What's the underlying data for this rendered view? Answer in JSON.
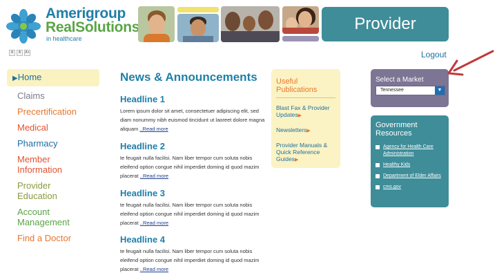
{
  "logo": {
    "line1": "Amerigroup",
    "line2": "RealSolutions",
    "line3": "in healthcare"
  },
  "header": {
    "banner": "Provider",
    "logout": "Logout",
    "text_size_buttons": [
      "A",
      "A",
      "A+"
    ]
  },
  "nav": {
    "items": [
      {
        "label": "Home",
        "color": "#1f6f9e",
        "active": true
      },
      {
        "label": "Claims",
        "color": "#7d7a8c"
      },
      {
        "label": "Precertification",
        "color": "#e8762c"
      },
      {
        "label": "Medical",
        "color": "#e2522f"
      },
      {
        "label": "Pharmacy",
        "color": "#1f6f9e"
      },
      {
        "label": "Member Information",
        "color": "#e2522f"
      },
      {
        "label": "Provider Education",
        "color": "#8a9a3c"
      },
      {
        "label": "Account Management",
        "color": "#5aa446"
      },
      {
        "label": "Find a Doctor",
        "color": "#e8762c"
      }
    ]
  },
  "news": {
    "title": "News & Announcements",
    "items": [
      {
        "headline": "Headline 1",
        "body": "Lorem ipsum dolor sit amet, consectetuer adipiscing elit, sed diam nonummy nibh euismod tincidunt ut laoreet dolore magna aliquam",
        "more": "..Read more"
      },
      {
        "headline": "Headline 2",
        "body": "te feugait nulla facilisi. Nam liber tempor cum soluta nobis eleifend option congue nihil imperdiet doming id quod mazim placerat",
        "more": "..Read more"
      },
      {
        "headline": "Headline 3",
        "body": "te feugait nulla facilisi. Nam liber tempor cum soluta nobis eleifend option congue nihil imperdiet doming id quod mazim placerat",
        "more": "..Read more"
      },
      {
        "headline": "Headline 4",
        "body": "te feugait nulla facilisi. Nam liber tempor cum soluta nobis eleifend option congue nihil imperdiet doming id quod mazim placerat",
        "more": "..Read more"
      }
    ]
  },
  "publications": {
    "title": "Useful Publications",
    "links": [
      "Blast Fax & Provider Updates",
      "Newsletters",
      "Provider Manuals & Quick Reference Guides"
    ]
  },
  "market": {
    "label": "Select a Market",
    "selected": "Tennessee"
  },
  "government": {
    "title": "Government Resources",
    "links": [
      "Agency for Health Care Administration",
      "Healthy Kids",
      "Department of Elder Affairs",
      "cms.gov"
    ]
  },
  "colors": {
    "teal": "#3e8d99",
    "market_purple": "#7c7594",
    "publications_bg": "#fbf3c4",
    "annotation_arrow": "#c0393b"
  }
}
